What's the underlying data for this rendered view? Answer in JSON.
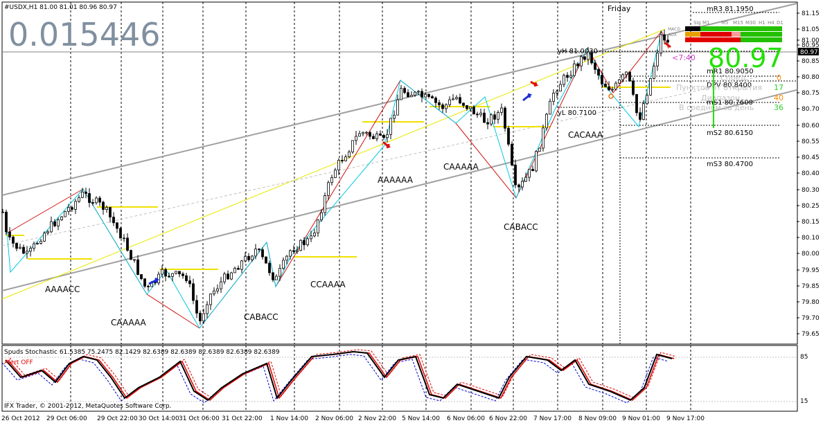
{
  "main_chart": {
    "header": "#USDX,H1  81.00 81.01 80.96 80.97",
    "big_value": "0.015446",
    "day_label": "Friday",
    "current_price_tag": "80.97",
    "big_price": "80.97",
    "timer": "<7:40",
    "price_axis": [
      "81.15",
      "81.05",
      "81.00",
      "80.95",
      "80.85",
      "80.80",
      "80.75",
      "80.70",
      "80.60",
      "80.55",
      "80.45",
      "80.40",
      "80.30",
      "80.25",
      "80.15",
      "80.10",
      "80.00",
      "79.95",
      "79.85",
      "79.80",
      "79.70",
      "79.65"
    ],
    "pattern_labels": [
      "AAAACC",
      "CAAAAA",
      "CABACC",
      "CCAAAA",
      "AAAAAA",
      "CAAAAA",
      "CABACC",
      "CACAAA"
    ],
    "levels": [
      {
        "label": "mR3 81.1950"
      },
      {
        "label": "yH 81.0030"
      },
      {
        "label": "mR1 80.9050"
      },
      {
        "label": "DPV 80.8400"
      },
      {
        "label": "mS1 80.7600"
      },
      {
        "label": "yL 80.7100"
      },
      {
        "label": "mS2 80.6150"
      },
      {
        "label": "mS3 80.4700"
      }
    ],
    "info_rows": [
      {
        "label": "Спред",
        "value": "0",
        "color": "#ff8c00"
      },
      {
        "label": "Пунктов от открытия",
        "value": "17",
        "color": "#32cd32"
      },
      {
        "label": "Диапазон",
        "value": "40",
        "color": "#ff8c00"
      },
      {
        "label": "В среднем за день",
        "value": "36",
        "color": "#32cd32"
      }
    ],
    "mtf_panel": {
      "caption": "Sig",
      "headers": [
        "M1",
        "M5",
        "M15",
        "M30",
        "H1",
        "H4",
        "D1"
      ],
      "row_labels": [
        "MACD",
        "ADX"
      ]
    }
  },
  "indicator": {
    "title": "Spuds Stochastic 61.5385 75.2475 82.1429 82.6389 82.6389 82.6389 82.6389 82.6389",
    "alert": "Alert OFF",
    "copyright": "IFX Trader, © 2001-2012, MetaQuotes Software Corp.",
    "axis": [
      "85",
      "15"
    ]
  },
  "time_axis": [
    "26 Oct 2012",
    "29 Oct 06:00",
    "29 Oct 22:00",
    "30 Oct 14:00",
    "31 Oct 06:00",
    "31 Oct 22:00",
    "1 Nov 14:00",
    "2 Nov 06:00",
    "2 Nov 22:00",
    "5 Nov 14:00",
    "6 Nov 06:00",
    "6 Nov 22:00",
    "7 Nov 17:00",
    "8 Nov 09:00",
    "9 Nov 01:00",
    "9 Nov 17:00"
  ]
}
